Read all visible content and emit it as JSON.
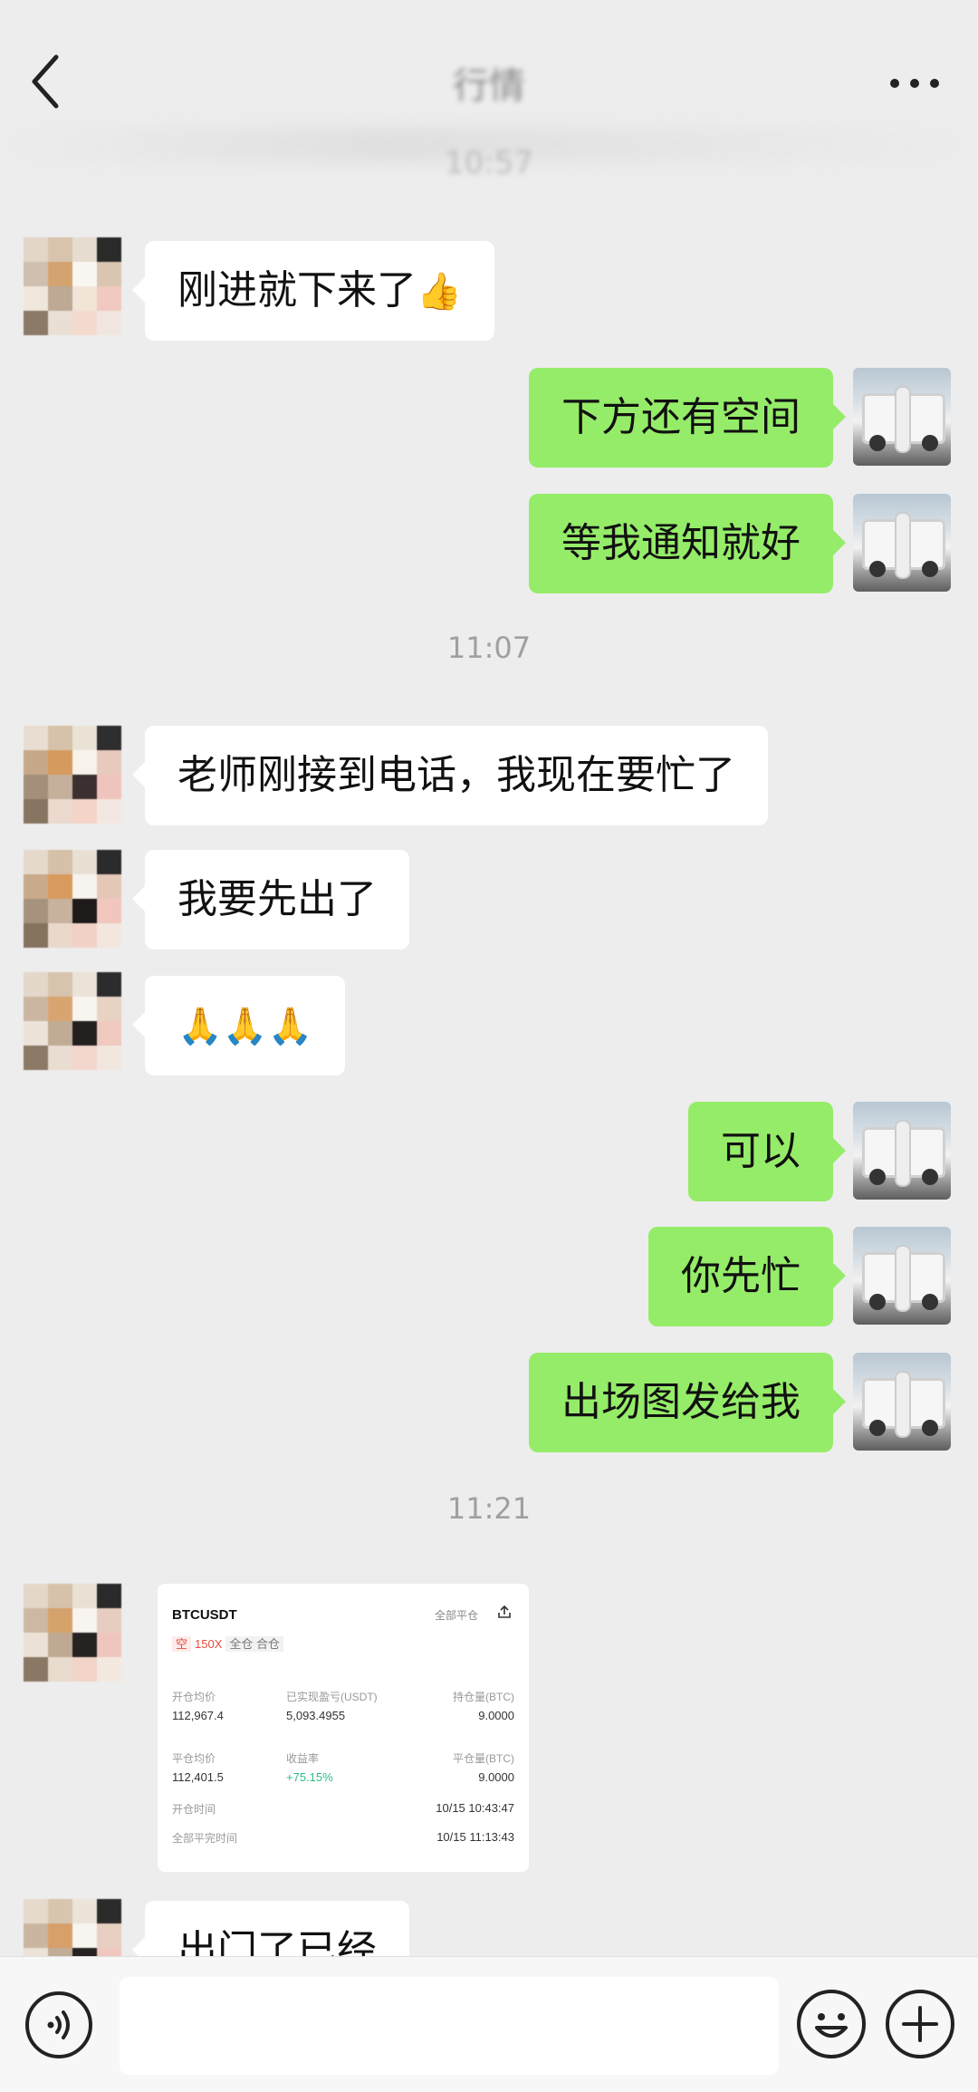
{
  "header": {
    "title": "行情",
    "blurred_time": "10:57"
  },
  "messages": {
    "m1": "刚进就下来了",
    "m2": "下方还有空间",
    "m3": "等我通知就好",
    "time2": "11:07",
    "m4": "老师刚接到电话，我现在要忙了",
    "m5": "我要先出了",
    "m6": "🙏🙏🙏",
    "m7": "可以",
    "m8": "你先忙",
    "m9": "出场图发给我",
    "time3": "11:21",
    "m10": "出门了已经"
  },
  "emoji": {
    "thumbs": "👍"
  },
  "trade_card": {
    "symbol": "BTCUSDT",
    "close_all": "全部平仓",
    "tag_short": "空",
    "leverage": "150X",
    "margin_mode": "全仓 合仓",
    "open_avg_label": "开仓均价",
    "open_avg_value": "112,967.4",
    "realized_pnl_label": "已实现盈亏(USDT)",
    "realized_pnl_value": "5,093.4955",
    "position_label": "持仓量(BTC)",
    "position_value": "9.0000",
    "close_avg_label": "平仓均价",
    "close_avg_value": "112,401.5",
    "yield_label": "收益率",
    "yield_value": "+75.15%",
    "close_qty_label": "平仓量(BTC)",
    "close_qty_value": "9.0000",
    "open_time_label": "开仓时间",
    "open_time_value": "10/15 10:43:47",
    "close_time_label": "全部平完时间",
    "close_time_value": "10/15 11:13:43"
  },
  "colors": {
    "background": "#ededed",
    "outgoing_bubble": "#95ec69",
    "incoming_bubble": "#ffffff",
    "gain": "#2ebd85",
    "short": "#e74c3c"
  },
  "icons": [
    "back-arrow-icon",
    "more-dots-icon",
    "voice-icon",
    "emoji-icon",
    "plus-icon",
    "share-icon"
  ]
}
